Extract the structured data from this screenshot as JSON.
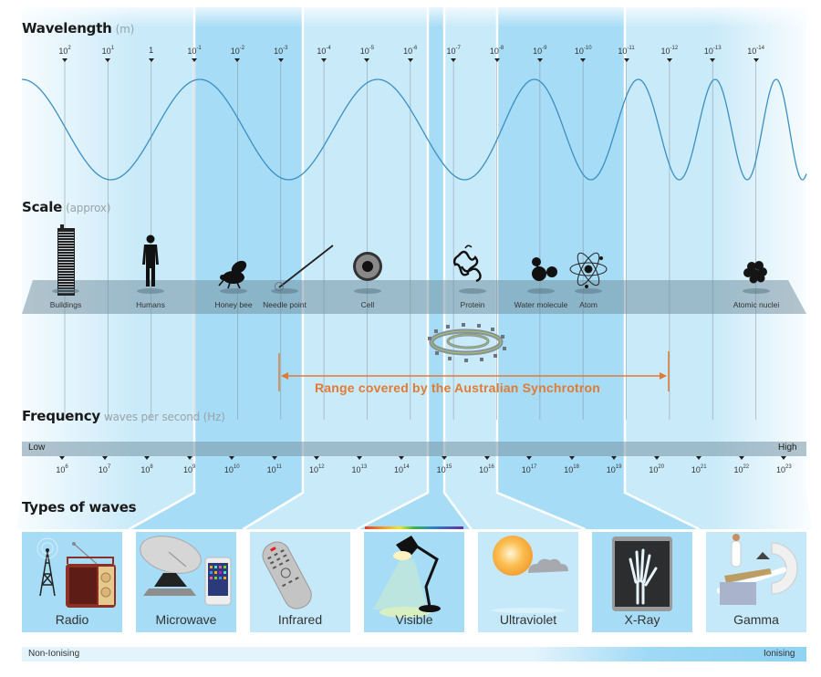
{
  "wavelength": {
    "title": "Wavelength",
    "unit": "(m)",
    "ticks": [
      {
        "base": "10",
        "exp": "2"
      },
      {
        "base": "10",
        "exp": "1"
      },
      {
        "base": "1",
        "exp": ""
      },
      {
        "base": "10",
        "exp": "-1"
      },
      {
        "base": "10",
        "exp": "-2"
      },
      {
        "base": "10",
        "exp": "-3"
      },
      {
        "base": "10",
        "exp": "-4"
      },
      {
        "base": "10",
        "exp": "-5"
      },
      {
        "base": "10",
        "exp": "-6"
      },
      {
        "base": "10",
        "exp": "-7"
      },
      {
        "base": "10",
        "exp": "-8"
      },
      {
        "base": "10",
        "exp": "-9"
      },
      {
        "base": "10",
        "exp": "-10"
      },
      {
        "base": "10",
        "exp": "-11"
      },
      {
        "base": "10",
        "exp": "-12"
      },
      {
        "base": "10",
        "exp": "-13"
      },
      {
        "base": "10",
        "exp": "-14"
      }
    ]
  },
  "scale": {
    "title": "Scale",
    "subtitle": "(approx)",
    "objects": [
      {
        "label": "Buildings",
        "icon": "building-icon",
        "wavelength_exp": 2
      },
      {
        "label": "Humans",
        "icon": "human-icon",
        "wavelength_exp": 0
      },
      {
        "label": "Honey bee",
        "icon": "bee-icon",
        "wavelength_exp": -2
      },
      {
        "label": "Needle point",
        "icon": "needle-icon",
        "wavelength_exp": -3
      },
      {
        "label": "Cell",
        "icon": "cell-icon",
        "wavelength_exp": -5
      },
      {
        "label": "Protein",
        "icon": "protein-icon",
        "wavelength_exp": -7
      },
      {
        "label": "Water molecule",
        "icon": "water-molecule-icon",
        "wavelength_exp": -9
      },
      {
        "label": "Atom",
        "icon": "atom-icon",
        "wavelength_exp": -10
      },
      {
        "label": "Atomic nuclei",
        "icon": "atomic-nucleus-icon",
        "wavelength_exp": -14
      }
    ]
  },
  "synchrotron": {
    "label": "Range covered by the Australian Synchrotron",
    "icon": "synchrotron-ring-icon",
    "range_wavelength_exp": [
      -3,
      -12
    ],
    "color": "#e07b36"
  },
  "frequency": {
    "title": "Frequency",
    "subtitle": "waves per second (Hz)",
    "low_label": "Low",
    "high_label": "High",
    "ticks": [
      {
        "base": "10",
        "exp": "6"
      },
      {
        "base": "10",
        "exp": "7"
      },
      {
        "base": "10",
        "exp": "8"
      },
      {
        "base": "10",
        "exp": "9"
      },
      {
        "base": "10",
        "exp": "10"
      },
      {
        "base": "10",
        "exp": "11"
      },
      {
        "base": "10",
        "exp": "12"
      },
      {
        "base": "10",
        "exp": "13"
      },
      {
        "base": "10",
        "exp": "14"
      },
      {
        "base": "10",
        "exp": "15"
      },
      {
        "base": "10",
        "exp": "16"
      },
      {
        "base": "10",
        "exp": "17"
      },
      {
        "base": "10",
        "exp": "18"
      },
      {
        "base": "10",
        "exp": "19"
      },
      {
        "base": "10",
        "exp": "20"
      },
      {
        "base": "10",
        "exp": "21"
      },
      {
        "base": "10",
        "exp": "22"
      },
      {
        "base": "10",
        "exp": "23"
      }
    ]
  },
  "types": {
    "title": "Types of waves",
    "waves": [
      {
        "label": "Radio",
        "icon": "radio-tower-icon"
      },
      {
        "label": "Microwave",
        "icon": "satellite-dish-icon"
      },
      {
        "label": "Infrared",
        "icon": "remote-control-icon"
      },
      {
        "label": "Visible",
        "icon": "desk-lamp-icon"
      },
      {
        "label": "Ultraviolet",
        "icon": "sun-cloud-icon"
      },
      {
        "label": "X-Ray",
        "icon": "xray-hand-icon"
      },
      {
        "label": "Gamma",
        "icon": "medical-scanner-icon"
      }
    ]
  },
  "ionising": {
    "left_label": "Non-Ionising",
    "right_label": "Ionising"
  },
  "colors": {
    "wave": "#3b8fc4",
    "band_dark": "#a6dcf5",
    "band_light": "#c9eaf9",
    "accent_orange": "#e07b36"
  }
}
